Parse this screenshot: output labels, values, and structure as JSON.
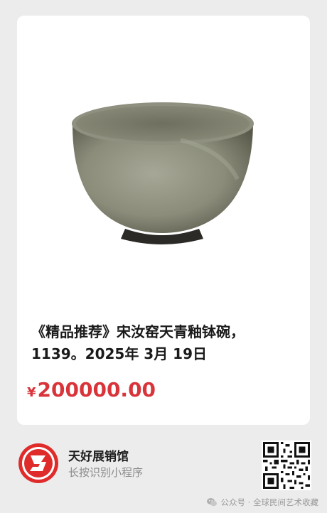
{
  "product": {
    "image_alt": "bowl",
    "title": "《精品推荐》宋汝窑天青釉钵碗，1139。2025年 3月 19日",
    "price_currency": "¥",
    "price_amount": "200000.00"
  },
  "shop": {
    "name": "天好展销馆",
    "hint": "长按识别小程序"
  },
  "watermark": {
    "text": "公众号 · 全球民间艺术收藏"
  },
  "colors": {
    "price": "#d8343a",
    "logo_red": "#e02b2b",
    "background": "#ececec"
  },
  "icons": {
    "logo": "shop-logo-icon",
    "qr": "qr-code-icon",
    "wechat": "wechat-icon"
  }
}
